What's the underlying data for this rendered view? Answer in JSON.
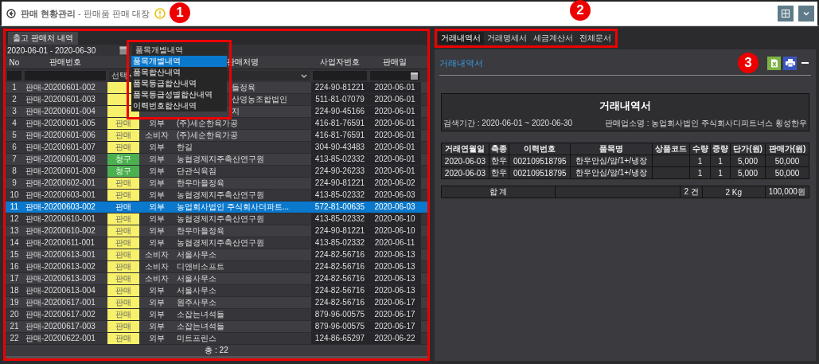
{
  "header": {
    "title": "**판매 현황관리** - 판매품 판매 대장"
  },
  "callouts": [
    {
      "label": "1"
    },
    {
      "label": "2"
    },
    {
      "label": "3"
    }
  ],
  "left": {
    "tab": "출고 판매처 내역",
    "date_range": "2020-06-01 - 2020-06-30",
    "select": {
      "value": "품목개별내역",
      "options": [
        {
          "label": "품목개별내역",
          "selected": true
        },
        {
          "label": "품목합산내역",
          "selected": false
        },
        {
          "label": "품목등급합산내역",
          "selected": false
        },
        {
          "label": "품목등급성별합산내역",
          "selected": false
        },
        {
          "label": "이력번호합산내역",
          "selected": false
        }
      ]
    },
    "columns": [
      {
        "label": "No"
      },
      {
        "label": "판매번호"
      },
      {},
      {},
      {
        "label": "판매처명"
      },
      {
        "label": "사업자번호"
      },
      {
        "label": "판매일"
      }
    ],
    "filters": [
      {
        "kind": "text"
      },
      {
        "kind": "text"
      },
      {
        "kind": "select",
        "value": "선택"
      },
      {
        "kind": "none"
      },
      {
        "kind": "select"
      },
      {
        "kind": "text"
      },
      {
        "kind": "date"
      }
    ],
    "rows": [
      {
        "no": "1",
        "id": "판매-20200601-002",
        "kind": "sale",
        "name": "들정육",
        "biz": "224-90-81221",
        "date": "2020-06-01",
        "covered": true,
        "selected": false
      },
      {
        "no": "2",
        "id": "판매-20200601-003",
        "kind": "sale",
        "name": "산영농조합법인",
        "biz": "511-81-07079",
        "date": "2020-06-01",
        "covered": true,
        "selected": false
      },
      {
        "no": "3",
        "id": "판매-20200601-004",
        "kind": "sale",
        "name": "지",
        "biz": "224-90-45166",
        "date": "2020-06-01",
        "covered": true,
        "selected": false
      },
      {
        "no": "4",
        "id": "판매-20200601-005",
        "status": "판매",
        "kind": "sale",
        "type": "외부",
        "name": "(주)세순한육가공",
        "biz": "416-81-76591",
        "date": "2020-06-01",
        "covered": false,
        "selected": false
      },
      {
        "no": "5",
        "id": "판매-20200601-006",
        "status": "판매",
        "kind": "sale",
        "type": "소비자",
        "name": "(주)세순한육가공",
        "biz": "416-81-76591",
        "date": "2020-06-01",
        "covered": false,
        "selected": false
      },
      {
        "no": "6",
        "id": "판매-20200601-007",
        "status": "판매",
        "kind": "sale",
        "type": "외부",
        "name": "한길",
        "biz": "304-90-43483",
        "date": "2020-06-01",
        "covered": false,
        "selected": false
      },
      {
        "no": "7",
        "id": "판매-20200601-008",
        "status": "청구",
        "kind": "claim",
        "type": "외부",
        "name": "농협경제지주축산연구원",
        "biz": "413-85-02332",
        "date": "2020-06-01",
        "covered": false,
        "selected": false
      },
      {
        "no": "8",
        "id": "판매-20200601-009",
        "status": "청구",
        "kind": "claim",
        "type": "외부",
        "name": "단관식육점",
        "biz": "224-90-26233",
        "date": "2020-06-01",
        "covered": false,
        "selected": false
      },
      {
        "no": "9",
        "id": "판매-20200602-001",
        "status": "판매",
        "kind": "sale",
        "type": "외부",
        "name": "한우마을정육",
        "biz": "224-90-81221",
        "date": "2020-06-02",
        "covered": false,
        "selected": false
      },
      {
        "no": "10",
        "id": "판매-20200603-001",
        "status": "판매",
        "kind": "sale",
        "type": "외부",
        "name": "농협경제지주축산연구원",
        "biz": "413-85-02332",
        "date": "2020-06-03",
        "covered": false,
        "selected": false
      },
      {
        "no": "11",
        "id": "판매-20200603-002",
        "status": "판매",
        "kind": "sale",
        "type": "외부",
        "name": "농업회사법인 주식회사더파트...",
        "biz": "572-81-00635",
        "date": "2020-06-03",
        "covered": false,
        "selected": true
      },
      {
        "no": "12",
        "id": "판매-20200610-001",
        "status": "판매",
        "kind": "sale",
        "type": "외부",
        "name": "농협경제지주축산연구원",
        "biz": "413-85-02332",
        "date": "2020-06-10",
        "covered": false,
        "selected": false
      },
      {
        "no": "13",
        "id": "판매-20200610-002",
        "status": "판매",
        "kind": "sale",
        "type": "외부",
        "name": "한우마을정육",
        "biz": "224-90-81221",
        "date": "2020-06-10",
        "covered": false,
        "selected": false
      },
      {
        "no": "14",
        "id": "판매-20200611-001",
        "status": "판매",
        "kind": "sale",
        "type": "외부",
        "name": "농협경제지주축산연구원",
        "biz": "413-85-02332",
        "date": "2020-06-11",
        "covered": false,
        "selected": false
      },
      {
        "no": "15",
        "id": "판매-20200613-001",
        "status": "판매",
        "kind": "sale",
        "type": "소비자",
        "name": "서울사무소",
        "biz": "224-82-56716",
        "date": "2020-06-13",
        "covered": false,
        "selected": false
      },
      {
        "no": "16",
        "id": "판매-20200613-002",
        "status": "판매",
        "kind": "sale",
        "type": "소비자",
        "name": "디앤비소프트",
        "biz": "224-82-56716",
        "date": "2020-06-13",
        "covered": false,
        "selected": false
      },
      {
        "no": "17",
        "id": "판매-20200613-003",
        "status": "판매",
        "kind": "sale",
        "type": "소비자",
        "name": "서울사무소",
        "biz": "224-82-56716",
        "date": "2020-06-13",
        "covered": false,
        "selected": false
      },
      {
        "no": "18",
        "id": "판매-20200613-004",
        "status": "판매",
        "kind": "sale",
        "type": "외부",
        "name": "서울사무소",
        "biz": "224-82-56716",
        "date": "2020-06-13",
        "covered": false,
        "selected": false
      },
      {
        "no": "19",
        "id": "판매-20200617-001",
        "status": "판매",
        "kind": "sale",
        "type": "외부",
        "name": "원주사무소",
        "biz": "224-82-56716",
        "date": "2020-06-17",
        "covered": false,
        "selected": false
      },
      {
        "no": "20",
        "id": "판매-20200617-002",
        "status": "판매",
        "kind": "sale",
        "type": "외부",
        "name": "소잡는녀석들",
        "biz": "879-96-00575",
        "date": "2020-06-17",
        "covered": false,
        "selected": false
      },
      {
        "no": "21",
        "id": "판매-20200617-003",
        "status": "판매",
        "kind": "sale",
        "type": "외부",
        "name": "소잡는녀석들",
        "biz": "879-96-00575",
        "date": "2020-06-17",
        "covered": false,
        "selected": false
      },
      {
        "no": "22",
        "id": "판매-20200622-001",
        "status": "판매",
        "kind": "sale",
        "type": "외부",
        "name": "미트프린스",
        "biz": "124-86-65297",
        "date": "2020-06-22",
        "covered": false,
        "selected": false
      }
    ],
    "total": "총 : 22"
  },
  "right": {
    "tabs": [
      {
        "label": "거래내역서",
        "selected": true
      },
      {
        "label": "거래명세서",
        "selected": false
      },
      {
        "label": "세금계산서",
        "selected": false
      },
      {
        "label": "전체문서",
        "selected": false
      }
    ],
    "panel_title": "거래내역서",
    "document": {
      "title": "거래내역서",
      "period": "검색기간 : 2020-06-01 ~ 2020-06-30",
      "seller": "판매업소명 : 농업회사법인 주식회사디피트너스 횡성한우",
      "columns": [
        "거래연월일",
        "축종",
        "이력번호",
        "품목명",
        "상품코드",
        "수량",
        "중량",
        "단가(원)",
        "판매가(원)"
      ],
      "rows": [
        [
          "2020-06-03",
          "한우",
          "002109518795",
          "한우안심/암/1+/냉장",
          "",
          "1",
          "1",
          "5,000",
          "50,000"
        ],
        [
          "2020-06-03",
          "한우",
          "002109518795",
          "한우안심/암/1+/냉장",
          "",
          "1",
          "1",
          "5,000",
          "50,000"
        ]
      ],
      "total": {
        "label": "합 계",
        "count": "2 건",
        "weight": "2 Kg",
        "amount": "100,000원"
      }
    }
  }
}
